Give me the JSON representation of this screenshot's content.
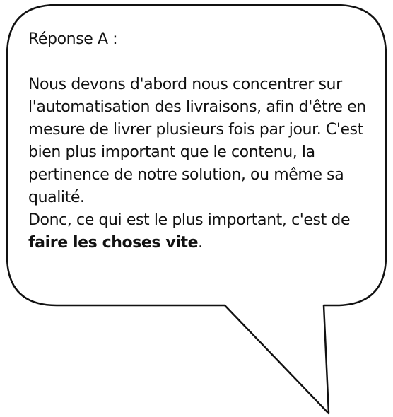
{
  "bubble": {
    "title": "Réponse A :",
    "paragraph1": "Nous devons d'abord nous concentrer sur l'automatisation des livraisons, afin d'être en mesure de livrer plusieurs fois par jour. C'est bien plus important que le contenu, la pertinence de notre solution, ou même sa qualité.",
    "paragraph2_prefix": "Donc, ce qui est le plus important, c'est de ",
    "paragraph2_bold": "faire les choses vite",
    "paragraph2_suffix": "."
  }
}
